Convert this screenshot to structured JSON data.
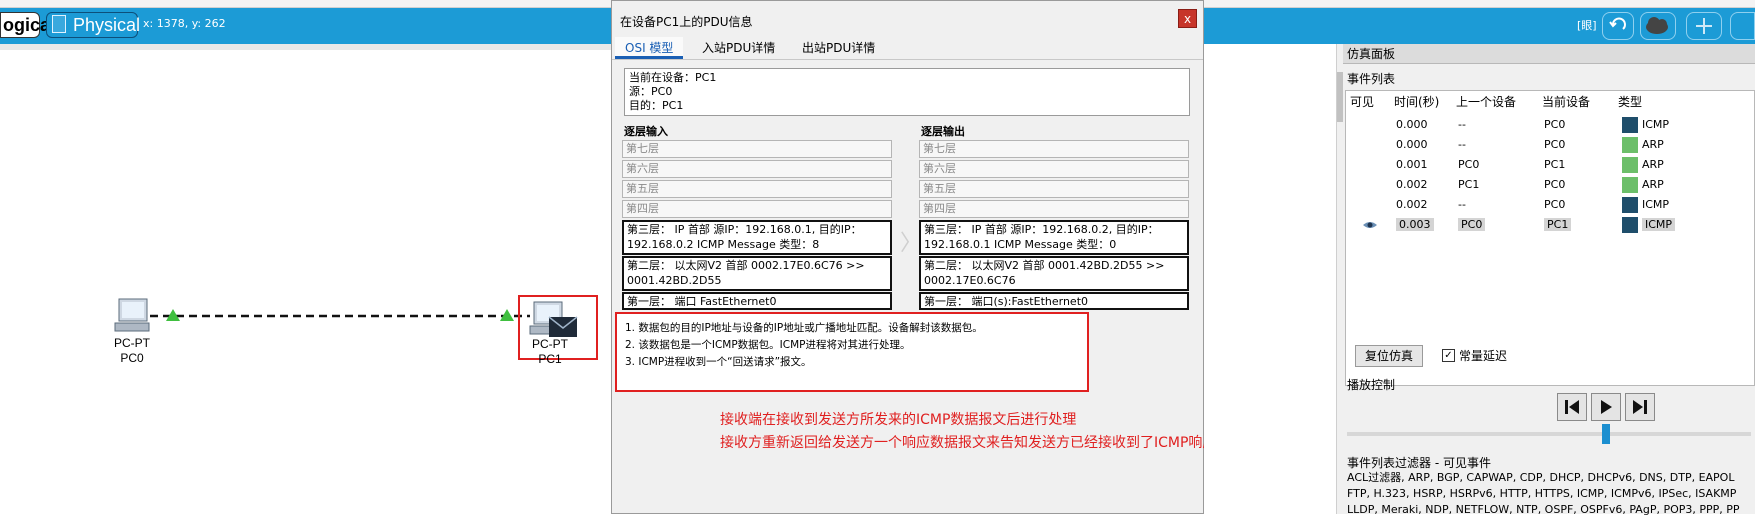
{
  "toolbar": {
    "logical_tab": "ogical",
    "physical_tab": "Physical",
    "coords": "x: 1378, y: 262",
    "right_label": "[眼]"
  },
  "workspace": {
    "pc0": {
      "type": "PC-PT",
      "name": "PC0"
    },
    "pc1": {
      "type": "PC-PT",
      "name": "PC1"
    }
  },
  "pdu": {
    "title": "在设备PC1上的PDU信息",
    "close": "x",
    "tabs": [
      "OSI 模型",
      "入站PDU详情",
      "出站PDU详情"
    ],
    "info": {
      "current": "当前在设备：PC1",
      "source": "源：PC0",
      "dest": "目的：PC1"
    },
    "in_title": "逐层输入",
    "out_title": "逐层输出",
    "in_layers": [
      "第七层",
      "第六层",
      "第五层",
      "第四层",
      "第三层：  IP 首部 源IP：192.168.0.1, 目的IP：192.168.0.2 ICMP Message 类型：8",
      "第二层：  以太网V2 首部 0002.17E0.6C76 >> 0001.42BD.2D55",
      "第一层：  端口 FastEthernet0"
    ],
    "out_layers": [
      "第七层",
      "第六层",
      "第五层",
      "第四层",
      "第三层：  IP 首部 源IP：192.168.0.2, 目的IP：192.168.0.1 ICMP Message 类型：0",
      "第二层：  以太网V2 首部 0001.42BD.2D55 >> 0002.17E0.6C76",
      "第一层：  端口(s):FastEthernet0"
    ],
    "notes": [
      "1. 数据包的目的IP地址与设备的IP地址或广播地址匹配。设备解封该数据包。",
      "2. 该数据包是一个ICMP数据包。ICMP进程将对其进行处理。",
      "3. ICMP进程收到一个“回送请求”报文。"
    ]
  },
  "annotation": {
    "line1": "接收端在接收到发送方所发来的ICMP数据报文后进行处理",
    "line2": "接收方重新返回给发送方一个响应数据报文来告知发送方已经接收到了ICMP响应报文对象。"
  },
  "sim_panel": {
    "title": "仿真面板",
    "event_list_label": "事件列表",
    "headers": [
      "可见",
      "时间(秒)",
      "上一个设备",
      "当前设备",
      "类型"
    ],
    "events": [
      {
        "time": "0.000",
        "last": "--",
        "at": "PC0",
        "type": "ICMP",
        "color": "#1f4e6b",
        "current": false
      },
      {
        "time": "0.000",
        "last": "--",
        "at": "PC0",
        "type": "ARP",
        "color": "#6cbf6a",
        "current": false
      },
      {
        "time": "0.001",
        "last": "PC0",
        "at": "PC1",
        "type": "ARP",
        "color": "#6cbf6a",
        "current": false
      },
      {
        "time": "0.002",
        "last": "PC1",
        "at": "PC0",
        "type": "ARP",
        "color": "#6cbf6a",
        "current": false
      },
      {
        "time": "0.002",
        "last": "--",
        "at": "PC0",
        "type": "ICMP",
        "color": "#1f4e6b",
        "current": false
      },
      {
        "time": "0.003",
        "last": "PC0",
        "at": "PC1",
        "type": "ICMP",
        "color": "#1f4e6b",
        "current": true
      }
    ],
    "reset_button": "复位仿真",
    "constant_delay": "常量延迟",
    "constant_delay_checked": true,
    "playback_label": "播放控制",
    "playback_position": 0.64,
    "filter_title": "事件列表过滤器 - 可见事件",
    "filter_lines": [
      "ACL过滤器, ARP, BGP, CAPWAP, CDP, DHCP, DHCPv6, DNS, DTP, EAPOL",
      "FTP, H.323, HSRP, HSRPv6, HTTP, HTTPS, ICMP, ICMPv6, IPSec, ISAKMP",
      "LLDP, Meraki, NDP, NETFLOW, NTP, OSPF, OSPFv6, PAgP, POP3, PPP, PP"
    ]
  },
  "colors": {
    "toolbar_blue": "#1c9bd6",
    "annotation_red": "#e02020",
    "tab_blue": "#1a5fb4"
  }
}
